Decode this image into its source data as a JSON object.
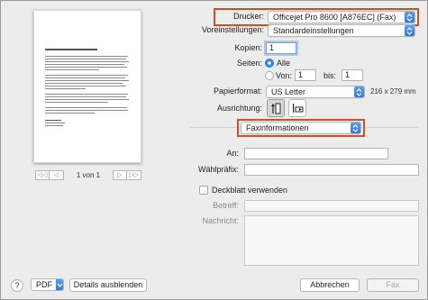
{
  "printer": {
    "label": "Drucker:",
    "value": "Officejet Pro 8600 [A876EC] (Fax)"
  },
  "presets": {
    "label": "Voreinstellungen:",
    "value": "Standardeinstellungen"
  },
  "copies": {
    "label": "Kopien:",
    "value": "1"
  },
  "pages": {
    "label": "Seiten:",
    "all_label": "Alle",
    "from_label": "Von:",
    "from_value": "1",
    "to_label": "bis:",
    "to_value": "1",
    "selected": "all"
  },
  "paper": {
    "label": "Papierformat:",
    "value": "US Letter",
    "dimensions": "216 x 279 mm"
  },
  "orientation": {
    "label": "Ausrichtung:",
    "selected": "portrait"
  },
  "section_menu": {
    "value": "Faxinformationen"
  },
  "fax": {
    "to_label": "An:",
    "to_value": "",
    "dial_prefix_label": "Wählpräfix:",
    "dial_prefix_value": "",
    "cover_page_label": "Deckblatt verwenden",
    "cover_page_checked": false,
    "subject_label": "Betreff:",
    "subject_value": "",
    "message_label": "Nachricht:",
    "message_value": ""
  },
  "preview": {
    "page_counter": "1 von 1",
    "prev_symbol": "◁◁",
    "prev2_symbol": "◁",
    "next_symbol": "▷",
    "next2_symbol": "▷▷"
  },
  "footer": {
    "help_symbol": "?",
    "pdf_label": "PDF",
    "details_label": "Details ausblenden",
    "cancel_label": "Abbrechen",
    "fax_label": "Fax"
  },
  "colors": {
    "accent": "#2b77e4",
    "highlight": "#c9512a"
  },
  "icons": {
    "stepper": "chevron-up-down-icon",
    "portrait": "portrait-orientation-icon",
    "landscape": "landscape-orientation-icon"
  }
}
